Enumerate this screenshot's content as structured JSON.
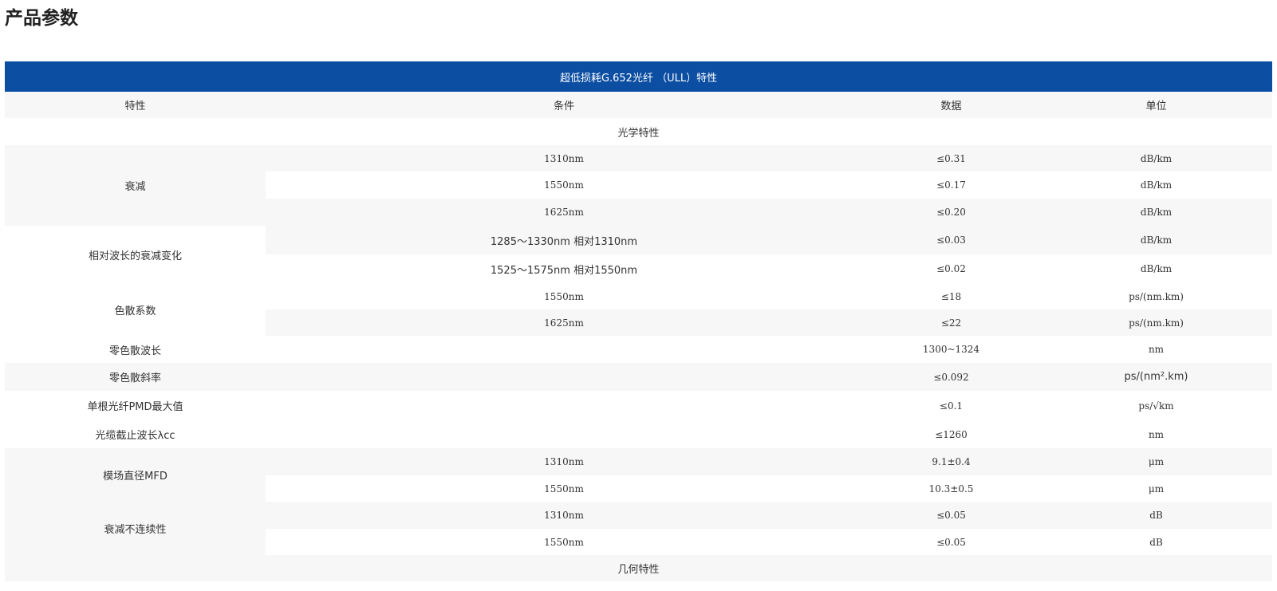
{
  "page_title": "产品参数",
  "table": {
    "caption": "超低损耗G.652光纤 （ULL）特性",
    "headers": [
      "特性",
      "条件",
      "数据",
      "单位"
    ],
    "section_optical": "光学特性",
    "section_geometric": "几何特性",
    "attenuation": {
      "label": "衰减",
      "rows": [
        {
          "condition": "1310nm",
          "value": "≤0.31",
          "unit": "dB/km"
        },
        {
          "condition": "1550nm",
          "value": "≤0.17",
          "unit": "dB/km"
        },
        {
          "condition": "1625nm",
          "value": "≤0.20",
          "unit": "dB/km"
        }
      ]
    },
    "attenuation_vs_wavelength": {
      "label": "相对波长的衰减变化",
      "rows": [
        {
          "condition": "1285～1330nm 相对1310nm",
          "value": "≤0.03",
          "unit": "dB/km"
        },
        {
          "condition": "1525～1575nm 相对1550nm",
          "value": "≤0.02",
          "unit": "dB/km"
        }
      ]
    },
    "chromatic_dispersion": {
      "label": "色散系数",
      "rows": [
        {
          "condition": "1550nm",
          "value": "≤18",
          "unit": "ps/(nm.km)"
        },
        {
          "condition": "1625nm",
          "value": "≤22",
          "unit": "ps/(nm.km)"
        }
      ]
    },
    "zero_dispersion_wavelength": {
      "label": "零色散波长",
      "value": "1300~1324",
      "unit": "nm"
    },
    "zero_dispersion_slope": {
      "label": "零色散斜率",
      "value": "≤0.092",
      "unit": "ps/(nm².km)"
    },
    "pmd": {
      "label": "单根光纤PMD最大值",
      "value": "≤0.1",
      "unit": "ps/√km"
    },
    "cutoff": {
      "label": "光缆截止波长λcc",
      "value": "≤1260",
      "unit": "nm"
    },
    "mfd": {
      "label": "模场直径MFD",
      "rows": [
        {
          "condition": "1310nm",
          "value": "9.1±0.4",
          "unit": "μm"
        },
        {
          "condition": "1550nm",
          "value": "10.3±0.5",
          "unit": "μm"
        }
      ]
    },
    "point_discontinuity": {
      "label": "衰减不连续性",
      "rows": [
        {
          "condition": "1310nm",
          "value": "≤0.05",
          "unit": "dB"
        },
        {
          "condition": "1550nm",
          "value": "≤0.05",
          "unit": "dB"
        }
      ]
    }
  },
  "colors": {
    "caption_bg": "#0c4ea2",
    "stripe": "#f7f7f7",
    "text": "#333333"
  }
}
